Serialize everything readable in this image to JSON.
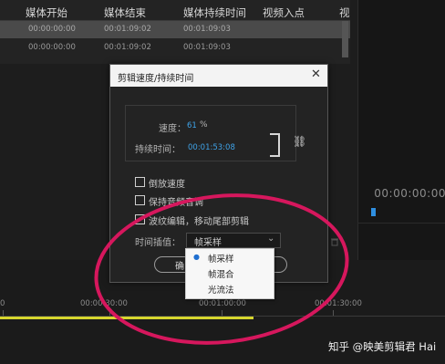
{
  "project_table": {
    "columns": [
      "媒体开始",
      "媒体结束",
      "媒体持续时间",
      "视频入点",
      "视"
    ],
    "rows": [
      [
        "00:00:00:00",
        "00:01:09:02",
        "00:01:09:03"
      ],
      [
        "00:00:00:00",
        "00:01:09:02",
        "00:01:09:03"
      ]
    ]
  },
  "right_panel": {
    "timecode": "00:00:00:00"
  },
  "timeline": {
    "ruler_labels": [
      "0",
      "00:00:30:00",
      "00:01:00:00",
      "00:01:30:00"
    ]
  },
  "dialog": {
    "title": "剪辑速度/持续时间",
    "close_glyph": "✕",
    "speed_label": "速度：",
    "speed_value": "61",
    "speed_unit": "%",
    "duration_label": "持续时间：",
    "duration_value": "00:01:53:08",
    "link_glyph": "🔗",
    "checkboxes": [
      {
        "label": "倒放速度",
        "checked": false
      },
      {
        "label": "保持音频音调",
        "checked": false
      },
      {
        "label": "波纹编辑，移动尾部剪辑",
        "checked": false
      }
    ],
    "interpolation_label": "时间插值：",
    "interpolation_value": "帧采样",
    "chevron_glyph": "⌄",
    "ok_label": "确"
  },
  "dropdown": {
    "bullet_glyph": "●",
    "options": [
      "帧采样",
      "帧混合",
      "光流法"
    ],
    "selected_index": 0
  },
  "colors": {
    "accent_blue": "#3fa3e8",
    "annotation_red": "#d6175d",
    "work_area_yellow": "#d7d62e"
  },
  "watermark": "知乎 @映美剪辑君 Hai"
}
